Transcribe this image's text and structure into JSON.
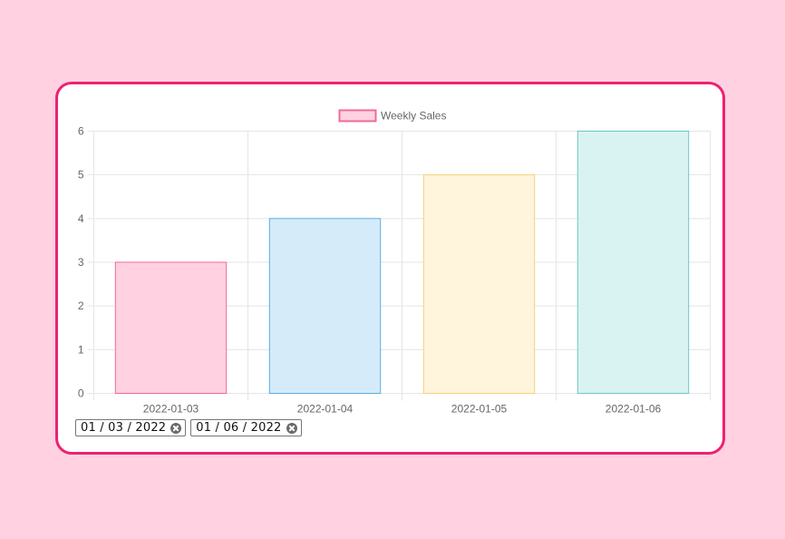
{
  "chart_data": {
    "type": "bar",
    "categories": [
      "2022-01-03",
      "2022-01-04",
      "2022-01-05",
      "2022-01-06"
    ],
    "series": [
      {
        "name": "Weekly Sales",
        "values": [
          3,
          4,
          5,
          6
        ]
      }
    ],
    "ylim": [
      0,
      6
    ],
    "yticks": [
      "0",
      "1",
      "2",
      "3",
      "4",
      "5",
      "6"
    ],
    "grid": true,
    "legend": "top-center",
    "bar_fills": [
      "#ffd1e1",
      "#d5ebf9",
      "#fff4dc",
      "#d9f3f3"
    ],
    "bar_strokes": [
      "#f06a98",
      "#5aaee6",
      "#f5d27a",
      "#6cc6c6"
    ],
    "grid_color": "#e5e5e5",
    "text_color": "#666666"
  },
  "date_filters": {
    "start": "01 / 03 / 2022",
    "end": "01 / 06 / 2022"
  },
  "colors": {
    "page_background": "#ffd1e1",
    "card_border": "#ee2170"
  }
}
